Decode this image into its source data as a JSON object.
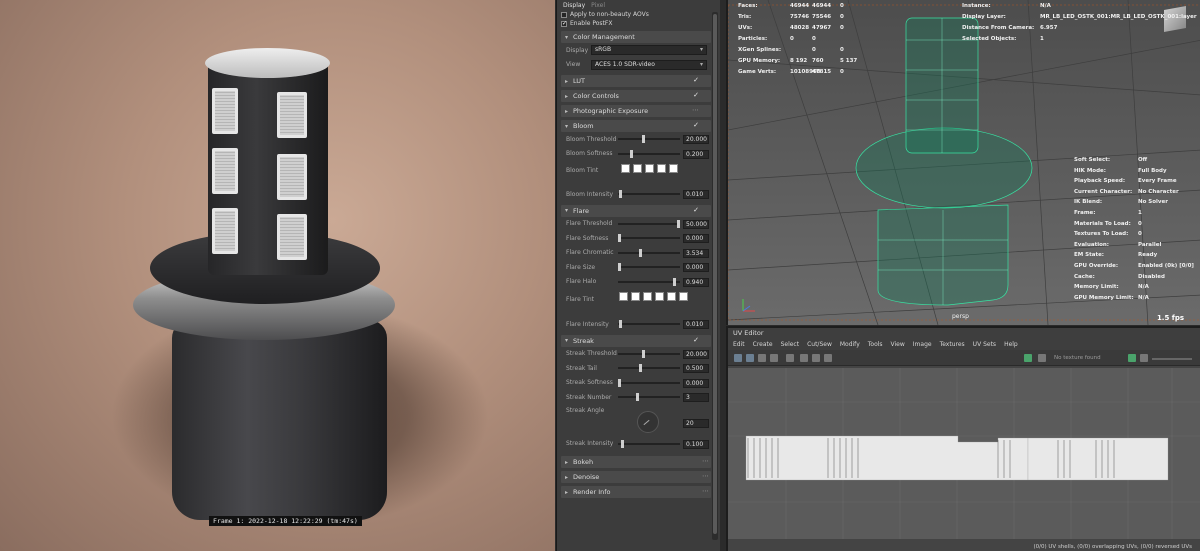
{
  "render": {
    "frame_label": "Frame 1:  2022-12-18  12:22:29  (tm:47s)"
  },
  "settings": {
    "tabs": [
      "Display",
      "Pixel"
    ],
    "checkboxes": [
      {
        "label": "Apply to non-beauty AOVs",
        "checked": false
      },
      {
        "label": "Enable PostFX",
        "checked": true
      }
    ],
    "color_management": {
      "title": "Color Management",
      "display_label": "Display",
      "display_value": "sRGB",
      "view_label": "View",
      "view_value": "ACES 1.0 SDR-video"
    },
    "sections_collapsed": [
      {
        "title": "LUT",
        "checked": true
      },
      {
        "title": "Color Controls",
        "checked": true
      },
      {
        "title": "Photographic Exposure",
        "checked": false
      }
    ],
    "bloom": {
      "title": "Bloom",
      "threshold": {
        "label": "Bloom Threshold",
        "value": "20.000",
        "pos": 0.4
      },
      "softness": {
        "label": "Bloom Softness",
        "value": "0.200",
        "pos": 0.2
      },
      "tint_label": "Bloom Tint",
      "tint_swatches": 5,
      "intensity": {
        "label": "Bloom Intensity",
        "value": "0.010",
        "pos": 0.02
      }
    },
    "flare": {
      "title": "Flare",
      "threshold": {
        "label": "Flare Threshold",
        "value": "50.000",
        "pos": 1.0
      },
      "softness": {
        "label": "Flare Softness",
        "value": "0.000",
        "pos": 0.0
      },
      "chromatic": {
        "label": "Flare Chromatic",
        "value": "3.534",
        "pos": 0.35
      },
      "size": {
        "label": "Flare Size",
        "value": "0.000",
        "pos": 0.0
      },
      "halo": {
        "label": "Flare Halo",
        "value": "0.940",
        "pos": 0.94
      },
      "tint_label": "Flare Tint",
      "tint_swatches": 6,
      "intensity": {
        "label": "Flare Intensity",
        "value": "0.010",
        "pos": 0.02
      }
    },
    "streak": {
      "title": "Streak",
      "threshold": {
        "label": "Streak Threshold",
        "value": "20.000",
        "pos": 0.4
      },
      "tail": {
        "label": "Streak Tail",
        "value": "0.500",
        "pos": 0.35
      },
      "softness": {
        "label": "Streak Softness",
        "value": "0.000",
        "pos": 0.0
      },
      "number": {
        "label": "Streak Number",
        "value": "3",
        "pos": 0.3
      },
      "angle_label": "Streak Angle",
      "angle_value": "20",
      "intensity": {
        "label": "Streak Intensity",
        "value": "0.100",
        "pos": 0.05
      }
    },
    "sections_bottom": [
      "Bokeh",
      "Denoise",
      "Render Info"
    ]
  },
  "viewport": {
    "hud_left": [
      [
        "Faces:",
        "46944",
        "46944",
        "0"
      ],
      [
        "Tris:",
        "75746",
        "75546",
        "0"
      ],
      [
        "UVs:",
        "48028",
        "47967",
        "0"
      ],
      [
        "Particles:",
        "0",
        "0",
        ""
      ],
      [
        "XGen Splines:",
        "",
        "0",
        "0"
      ],
      [
        "GPU Memory:",
        "8 192",
        "760",
        "5 137"
      ],
      [
        "Game Verts:",
        "10108900",
        "47815",
        "0"
      ]
    ],
    "hud_top_right": [
      [
        "Instance:",
        "N/A"
      ],
      [
        "Display Layer:",
        "MR_LB_LED_OSTK_001:MR_LB_LED_OSTK_001:layer"
      ],
      [
        "Distance From Camera:",
        "6.957"
      ],
      [
        "Selected Objects:",
        "1"
      ]
    ],
    "hud_right": [
      [
        "Soft Select:",
        "Off"
      ],
      [
        "HIK Mode:",
        "Full Body"
      ],
      [
        "Playback Speed:",
        "Every Frame"
      ],
      [
        "Current Character:",
        "No Character"
      ],
      [
        "IK Blend:",
        "No Solver"
      ],
      [
        "Frame:",
        "1"
      ],
      [
        "Materials To Load:",
        "0"
      ],
      [
        "Textures To Load:",
        "0"
      ],
      [
        "Evaluation:",
        "Parallel"
      ],
      [
        "EM State:",
        "Ready"
      ],
      [
        "GPU Override:",
        "Enabled (0k) [0/0]"
      ],
      [
        "Cache:",
        "Disabled"
      ],
      [
        "Memory Limit:",
        "N/A"
      ],
      [
        "GPU Memory Limit:",
        "N/A"
      ]
    ],
    "camera": "persp",
    "fps": "1.5 fps"
  },
  "uv_editor": {
    "title": "UV Editor",
    "menu": [
      "Edit",
      "Create",
      "Select",
      "Cut/Sew",
      "Modify",
      "Tools",
      "View",
      "Image",
      "Textures",
      "UV Sets",
      "Help"
    ],
    "texture_placeholder": "No texture found",
    "status": "(0/0) UV shells, (0/0) overlapping UVs, (0/0) reversed UVs"
  }
}
